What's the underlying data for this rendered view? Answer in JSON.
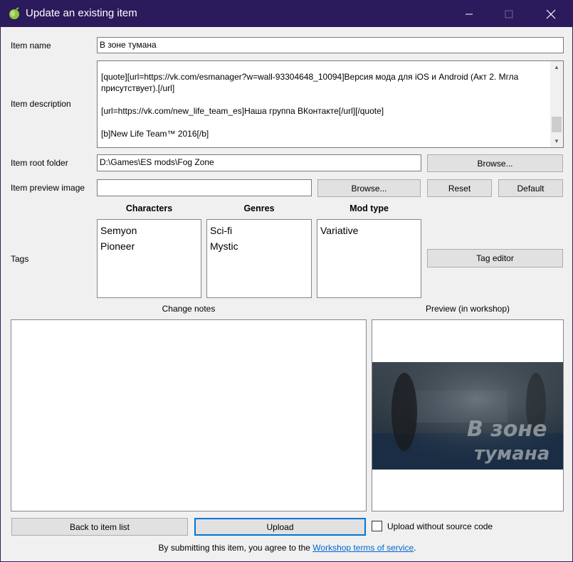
{
  "window": {
    "title": "Update an existing item",
    "titlebar_color": "#2b1a5c",
    "icons": {
      "app": "app-leaf-icon",
      "minimize": "minimize-icon",
      "maximize": "maximize-icon",
      "close": "close-icon"
    }
  },
  "form": {
    "item_name_label": "Item name",
    "item_name_value": "В зоне тумана",
    "item_description_label": "Item description",
    "item_description_lines": [
      "[quote][url=https://vk.com/esmanager?w=wall-93304648_10094]Версия мода для iOS и Android (Акт 2. Мгла присутствует).[/url]",
      "[url=https://vk.com/new_life_team_es]Наша группа ВКонтакте[/url][/quote]",
      "[b]New Life Team™ 2016[/b]"
    ],
    "item_root_folder_label": "Item root folder",
    "item_root_folder_value": "D:\\Games\\ES mods\\Fog Zone",
    "browse_folder_label": "Browse...",
    "item_preview_image_label": "Item preview image",
    "item_preview_image_value": "",
    "browse_image_label": "Browse...",
    "reset_label": "Reset",
    "default_label": "Default"
  },
  "tags": {
    "label": "Tags",
    "columns": [
      {
        "header": "Characters",
        "items": [
          "Semyon",
          "Pioneer"
        ]
      },
      {
        "header": "Genres",
        "items": [
          "Sci-fi",
          "Mystic"
        ]
      },
      {
        "header": "Mod type",
        "items": [
          "Variative"
        ]
      }
    ],
    "tag_editor_label": "Tag editor"
  },
  "change_notes": {
    "label": "Change notes",
    "value": ""
  },
  "preview": {
    "label": "Preview (in workshop)",
    "image_text_line1": "В зоне",
    "image_text_line2": "тумана"
  },
  "bottom": {
    "back_label": "Back to item list",
    "upload_label": "Upload",
    "upload_without_source_label": "Upload without source code",
    "upload_without_source_checked": false,
    "footer_prefix": "By submitting this item, you agree to the ",
    "footer_link": "Workshop terms of service",
    "footer_suffix": "."
  }
}
